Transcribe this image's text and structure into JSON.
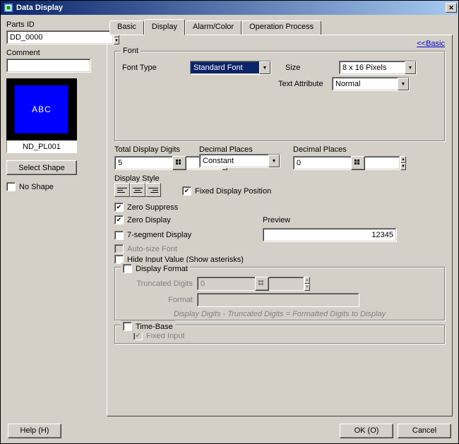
{
  "window": {
    "title": "Data Display"
  },
  "left": {
    "parts_id_label": "Parts ID",
    "parts_id_value": "DD_0000",
    "comment_label": "Comment",
    "comment_value": "",
    "preview_text": "ABC",
    "shape_name": "ND_PL001",
    "select_shape_btn": "Select Shape",
    "no_shape_label": "No Shape",
    "no_shape_checked": false
  },
  "tabs": {
    "items": [
      "Basic",
      "Display",
      "Alarm/Color",
      "Operation Process"
    ],
    "basic_link": "<<Basic"
  },
  "font": {
    "legend": "Font",
    "type_label": "Font Type",
    "type_value": "Standard Font",
    "size_label": "Size",
    "size_value": "8 x 16 Pixels",
    "attr_label": "Text Attribute",
    "attr_value": "Normal"
  },
  "digits": {
    "total_label": "Total Display Digits",
    "total_value": "5",
    "decimal_mode_label": "Decimal Places",
    "decimal_mode_value": "Constant",
    "decimal_value_label": "Decimal Places",
    "decimal_value": "0",
    "style_label": "Display Style",
    "fixed_pos_label": "Fixed Display Position",
    "fixed_pos_checked": true
  },
  "options": {
    "zero_suppress_label": "Zero Suppress",
    "zero_suppress_checked": true,
    "zero_display_label": "Zero Display",
    "zero_display_checked": true,
    "seven_seg_label": "7-segment Display",
    "seven_seg_checked": false,
    "autosize_label": "Auto-size Font",
    "autosize_checked": false,
    "hide_input_label": "Hide Input Value (Show asterisks)",
    "hide_input_checked": false,
    "preview_label": "Preview",
    "preview_value": "12345"
  },
  "display_format": {
    "legend_label": "Display Format",
    "legend_checked": false,
    "truncated_label": "Truncated Digits",
    "truncated_value": "0",
    "format_label": "Format",
    "format_value": "",
    "hint": "Display Digits - Truncated Digits = Formatted Digits to Display"
  },
  "time_base": {
    "legend_label": "Time-Base",
    "legend_checked": false,
    "fixed_input_label": "Fixed Input",
    "fixed_input_checked": true
  },
  "footer": {
    "help": "Help (H)",
    "ok": "OK (O)",
    "cancel": "Cancel"
  }
}
